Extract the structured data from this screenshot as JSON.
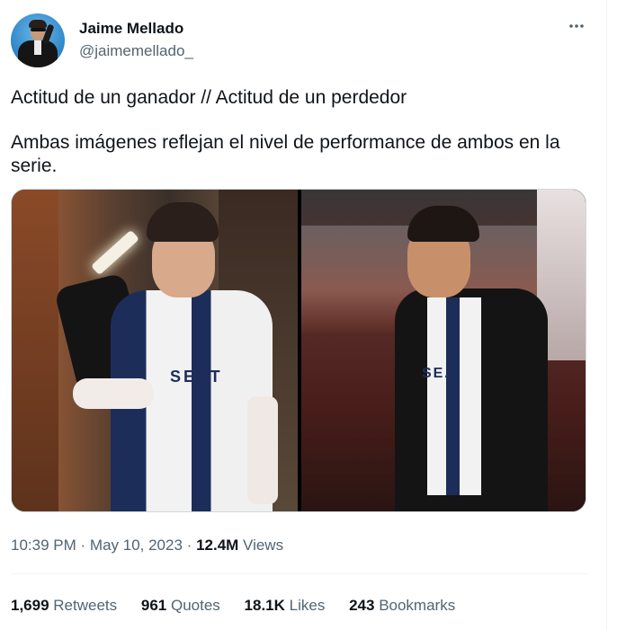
{
  "author": {
    "name": "Jaime Mellado",
    "handle": "@jaimemellado_"
  },
  "more_icon": "more-horizontal-icon",
  "tweet": {
    "line1": "Actitud de un ganador // Actitud de un perdedor",
    "line2": "Ambas imágenes reflejan el nivel de performance de ambos en la serie."
  },
  "media": {
    "left_logo": "SEAT",
    "right_logo": "SEA"
  },
  "meta": {
    "time": "10:39 PM",
    "date": "May 10, 2023",
    "sep": "·",
    "views_count": "12.4M",
    "views_label": "Views"
  },
  "stats": {
    "retweets_count": "1,699",
    "retweets_label": "Retweets",
    "quotes_count": "961",
    "quotes_label": "Quotes",
    "likes_count": "18.1K",
    "likes_label": "Likes",
    "bookmarks_count": "243",
    "bookmarks_label": "Bookmarks"
  },
  "colors": {
    "text": "#0f1419",
    "secondary": "#536471",
    "border": "#eff3f4"
  }
}
